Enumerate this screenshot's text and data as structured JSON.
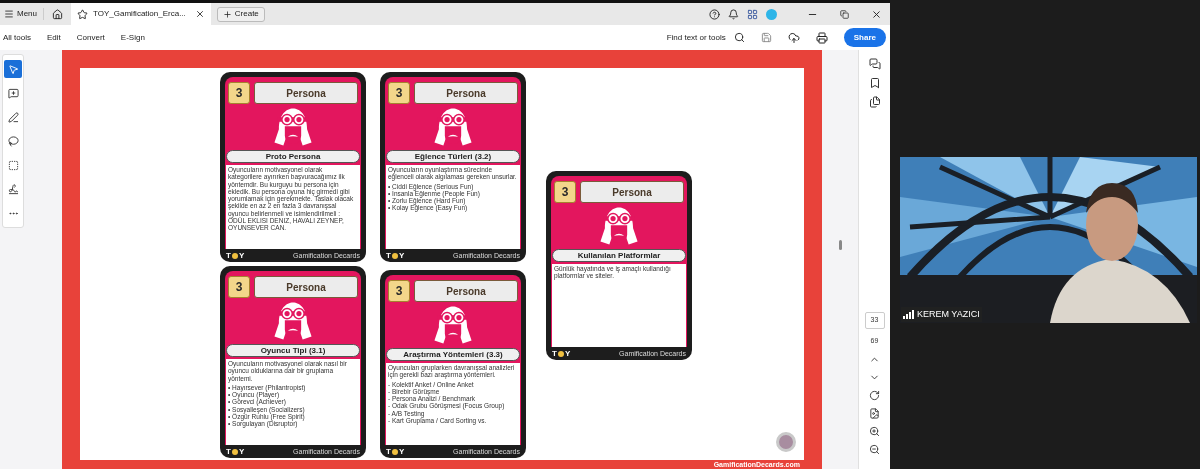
{
  "tab_bar": {
    "menu": "Menu",
    "tab_title": "TOY_Gamification_Erca...",
    "create": "Create"
  },
  "toolbar": {
    "items": [
      "All tools",
      "Edit",
      "Convert",
      "E-Sign"
    ],
    "search": "Find text or tools",
    "share": "Share"
  },
  "left_tools": [
    {
      "selected": true
    },
    {
      "selected": false
    },
    {
      "selected": false
    },
    {
      "selected": false
    },
    {
      "selected": false
    },
    {
      "selected": false
    },
    {
      "selected": false
    }
  ],
  "cards": [
    {
      "number": "3",
      "category": "Persona",
      "name": "Proto Persona",
      "intro": "Oyuncuların motivasyonel olarak kategorilere ayırırken başvuracağımız ilk yöntemdir. Bu kurguyu bu persona için ekledik. Bu persona oyuna hiç girmedi gibi yorumlamak için gerekmekte. Taslak olacak şekilde en az 2 en fazla 3 davranışsal oyuncu belirlenmeli ve isimlendirilmeli : ÖDÜL EKLISI DENIZ, HAVALI ZEYNEP, OYUNSEVER CAN.",
      "logo": [
        "T",
        "Y"
      ],
      "footer": "Gamification Decards"
    },
    {
      "number": "3",
      "category": "Persona",
      "name": "Eğlence Türleri (3.2)",
      "intro": "Oyuncuların oyunlaştırma sürecinde eğlenceli olarak algılaması gereken unsurlar.",
      "items": [
        "• Ciddi Eğlence (Serious Fun)",
        "• İnsanla Eğlenme (People Fun)",
        "• Zorlu Eğlence (Hard Fun)",
        "• Kolay Eğlence (Easy Fun)"
      ],
      "logo": [
        "T",
        "Y"
      ],
      "footer": "Gamification Decards"
    },
    {
      "number": "3",
      "category": "Persona",
      "name": "Kullanılan Platformlar",
      "intro": "Günlük hayatında ve iş amaçlı kullandığı platformlar ve siteler.",
      "logo": [
        "T",
        "Y"
      ],
      "footer": "Gamification Decards"
    },
    {
      "number": "3",
      "category": "Persona",
      "name": "Oyuncu Tipi (3.1)",
      "intro": "Oyuncuların motivasyonel olarak nasıl bir oyuncu olduklarına dair bir gruplama yöntemi.",
      "items": [
        "• Hayırsever (Philantropist)",
        "• Oyuncu (Player)",
        "• Görevci (Achiever)",
        "• Sosyalleşen (Socializers)",
        "• Özgür Ruhlu (Free Spirit)",
        "• Sorgulayan (Disruptor)"
      ],
      "logo": [
        "T",
        "Y"
      ],
      "footer": "Gamification Decards"
    },
    {
      "number": "3",
      "category": "Persona",
      "name": "Araştırma Yöntemleri (3.3)",
      "intro": "Oyuncuları gruplarken davranışsal analizleri için gerekli bazı araştırma yöntemleri.",
      "items": [
        "- Kolektif Anket / Online Anket",
        "- Birebir Görüşme",
        "- Persona Analizi / Benchmark",
        "- Odak Grubu Görüşmesi (Focus Group)",
        "- A/B Testing",
        "- Kart Gruplama / Card Sorting vs."
      ],
      "logo": [
        "T",
        "Y"
      ],
      "footer": "Gamification Decards"
    }
  ],
  "page_footer": "GamificationDecards.com",
  "page_nav": {
    "current": "33",
    "total": "69"
  },
  "video": {
    "name": "KEREM YAZICI"
  }
}
